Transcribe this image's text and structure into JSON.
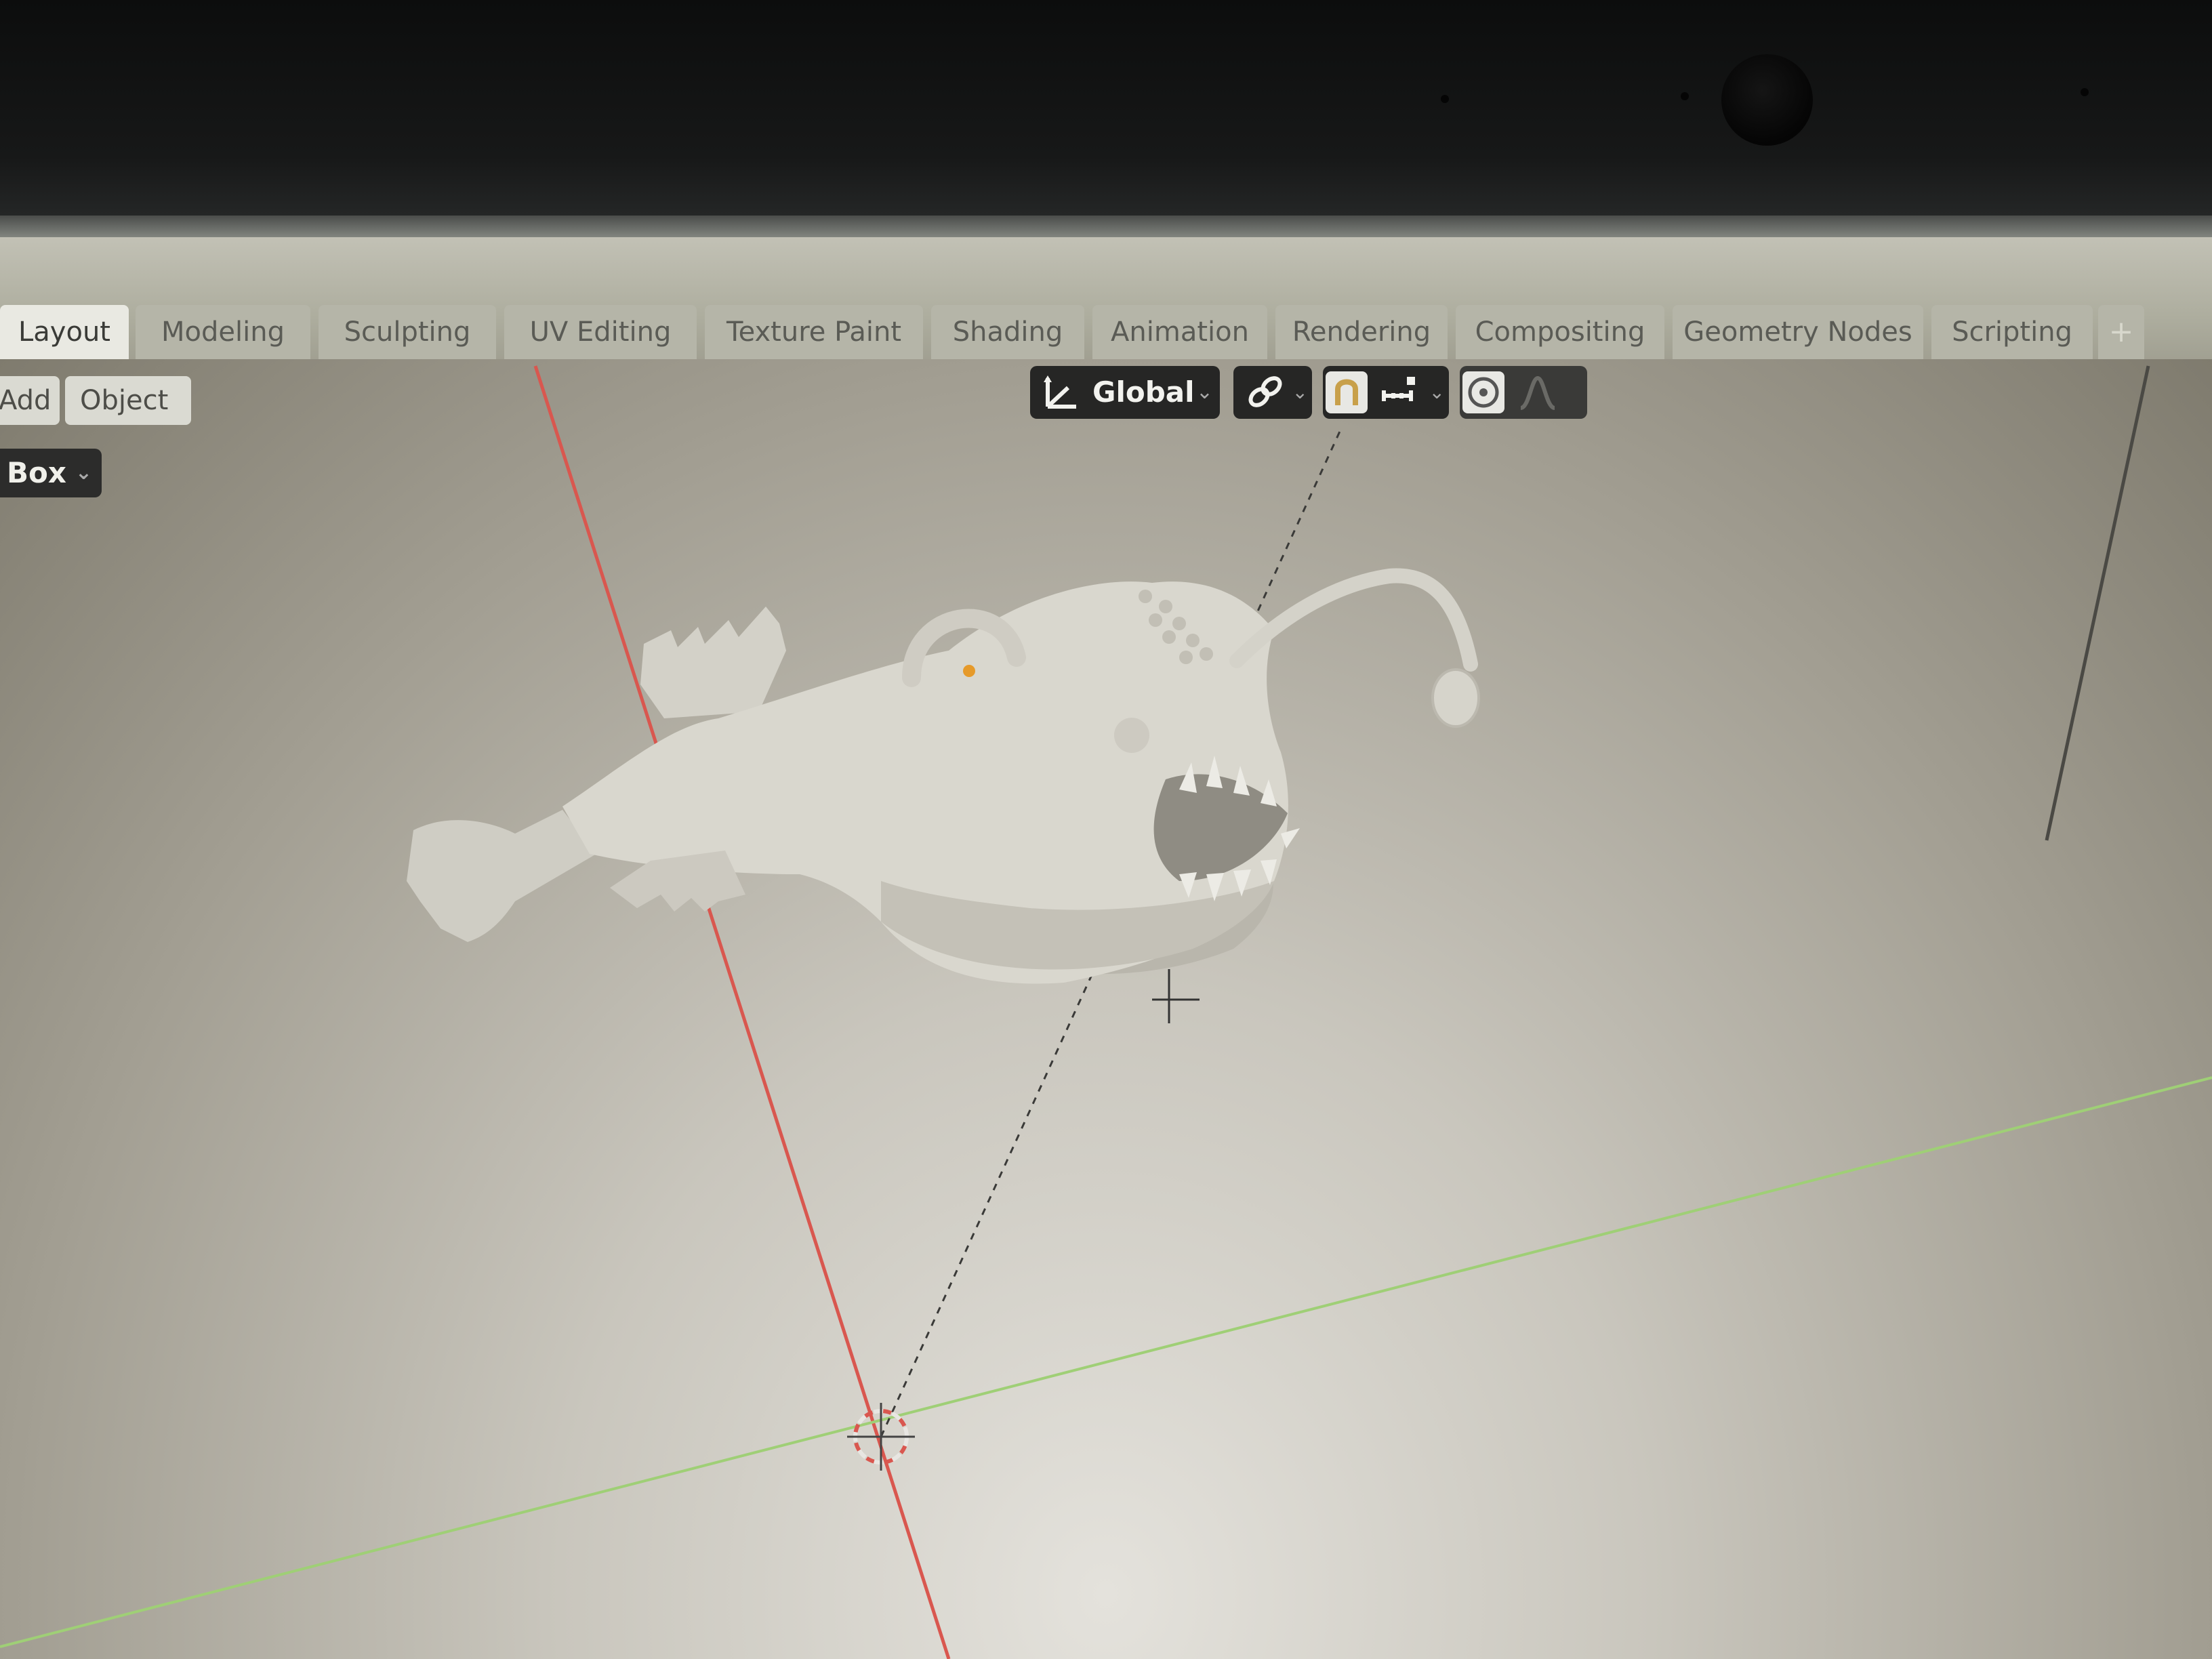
{
  "workspace_tabs": [
    {
      "label": "Layout",
      "active": true
    },
    {
      "label": "Modeling",
      "active": false
    },
    {
      "label": "Sculpting",
      "active": false
    },
    {
      "label": "UV Editing",
      "active": false
    },
    {
      "label": "Texture Paint",
      "active": false
    },
    {
      "label": "Shading",
      "active": false
    },
    {
      "label": "Animation",
      "active": false
    },
    {
      "label": "Rendering",
      "active": false
    },
    {
      "label": "Compositing",
      "active": false
    },
    {
      "label": "Geometry Nodes",
      "active": false
    },
    {
      "label": "Scripting",
      "active": false
    }
  ],
  "add_tab_label": "+",
  "header": {
    "add_label": "Add",
    "object_label": "Object",
    "select_mode": "Box",
    "transform_orientation": "Global"
  },
  "colors": {
    "x_axis": "#d9574f",
    "y_axis": "#9fcf76",
    "mesh": "#d7d5cc",
    "origin_dot": "#e69a2a"
  },
  "icons": {
    "orientation": "transform-orientation-icon",
    "pivot": "link-pivot-icon",
    "snap": "magnet-snap-icon",
    "snap_target": "snap-increment-icon",
    "proportional": "proportional-edit-icon",
    "falloff": "falloff-curve-icon",
    "camera": "webcam-icon"
  },
  "scene": {
    "object": "anglerfish-mesh"
  }
}
